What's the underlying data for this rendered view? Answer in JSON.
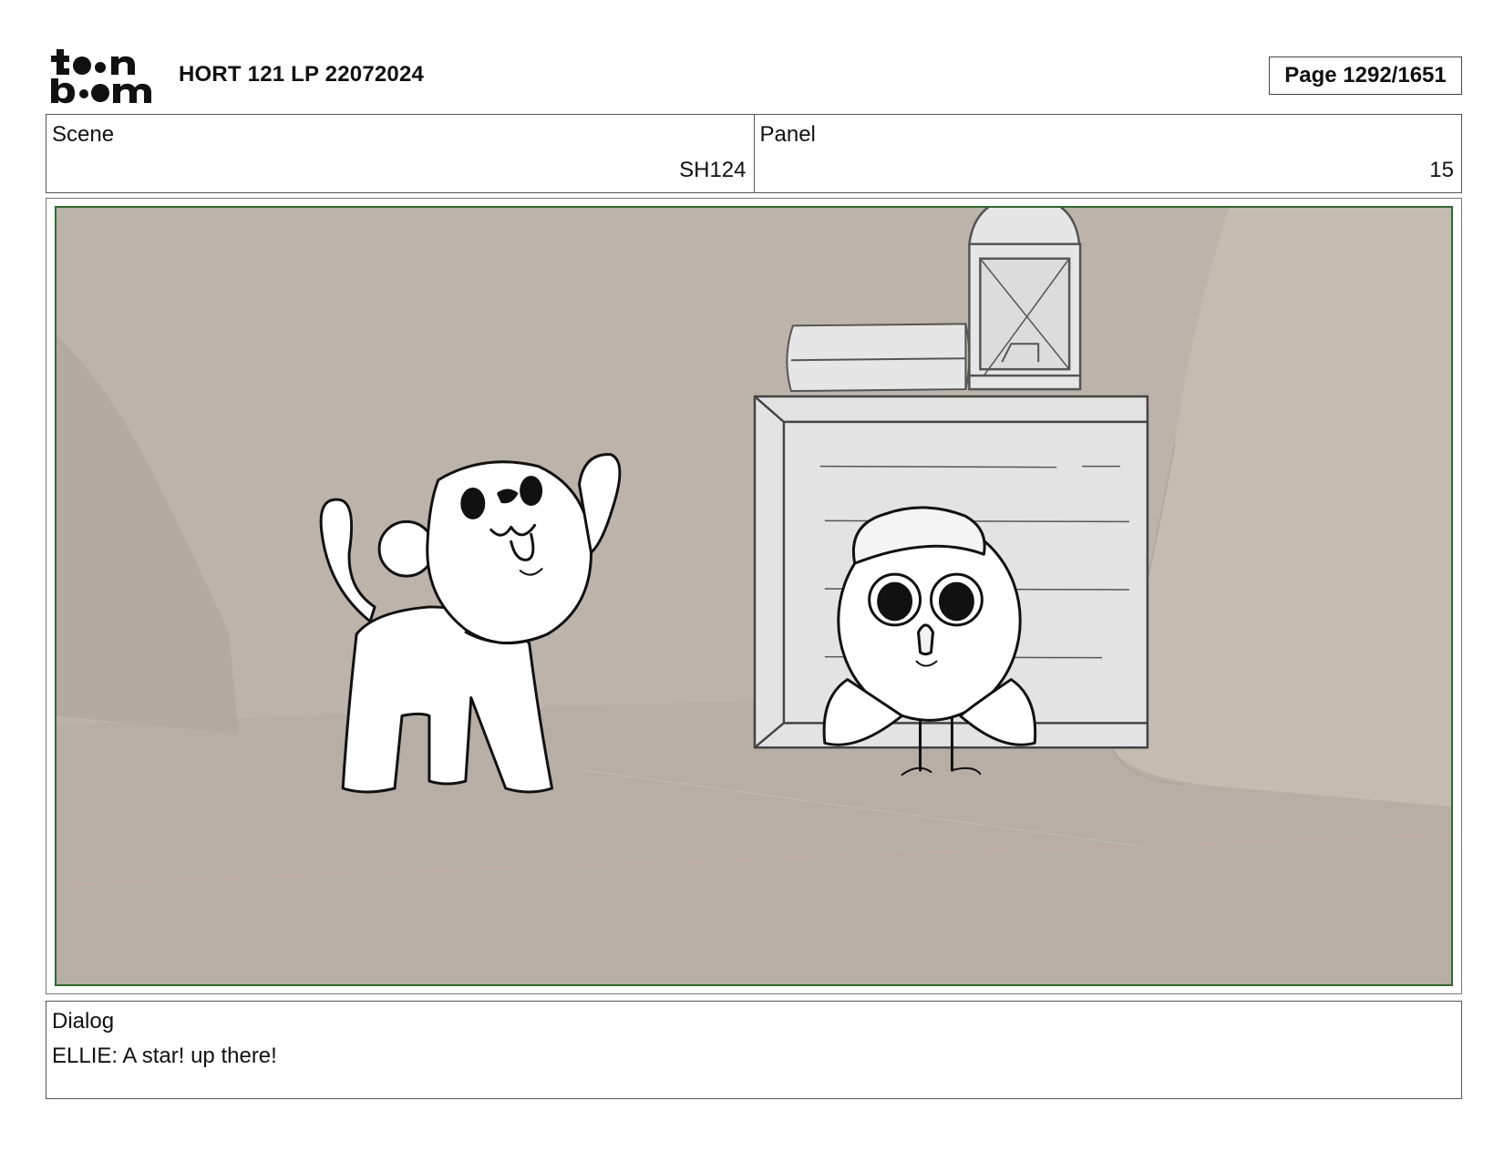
{
  "header": {
    "logo_top": "t••n",
    "logo_bottom": "b••m",
    "title": "HORT 121 LP 22072024",
    "page_label": "Page 1292/1651"
  },
  "info": {
    "scene_label": "Scene",
    "scene_value": "SH124",
    "panel_label": "Panel",
    "panel_value": "15"
  },
  "dialog": {
    "label": "Dialog",
    "text": "ELLIE: A star! up there!"
  },
  "colors": {
    "frame_green": "#2f6b2a",
    "background_wall": "#bdb5ab",
    "floor": "#b8b0a6"
  }
}
